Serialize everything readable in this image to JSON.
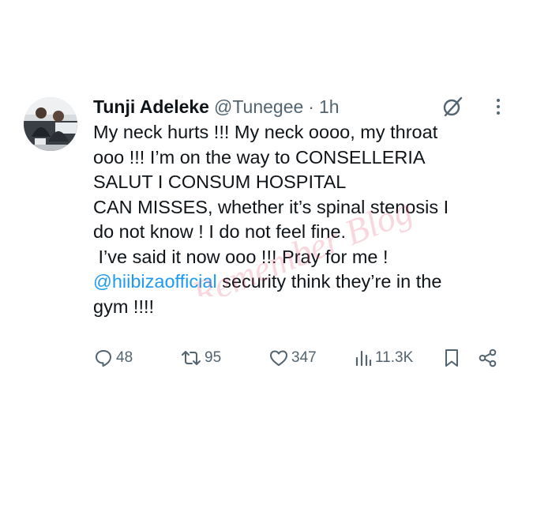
{
  "tweet": {
    "author_name": "Tunji Adeleke",
    "handle": "@Tunegee",
    "separator": "·",
    "time": "1h",
    "lines": [
      "My neck hurts !!! My neck oooo, my throat",
      "ooo !!! I’m on the way to CONSELLERIA",
      "SALUT I CONSUM HOSPITAL",
      "CAN MISSES, whether it’s spinal stenosis I",
      "do not know ! I do not feel fine.",
      " I’ve said it now ooo !!! Pray for me !"
    ],
    "mention": "@hiibizaofficial",
    "mention_tail": " security think they’re in the",
    "last_line": "gym !!!!"
  },
  "actions": {
    "replies": "48",
    "reposts": "95",
    "likes": "347",
    "views": "11.3K"
  },
  "watermark": {
    "text": "Remember Blog"
  },
  "colors": {
    "text": "#0f1419",
    "secondary": "#536471",
    "link": "#1d9bf0",
    "watermark": "#e0486a"
  },
  "icons": [
    "grok-icon",
    "more-icon",
    "reply-icon",
    "repost-icon",
    "like-icon",
    "views-icon",
    "bookmark-icon",
    "share-icon"
  ]
}
